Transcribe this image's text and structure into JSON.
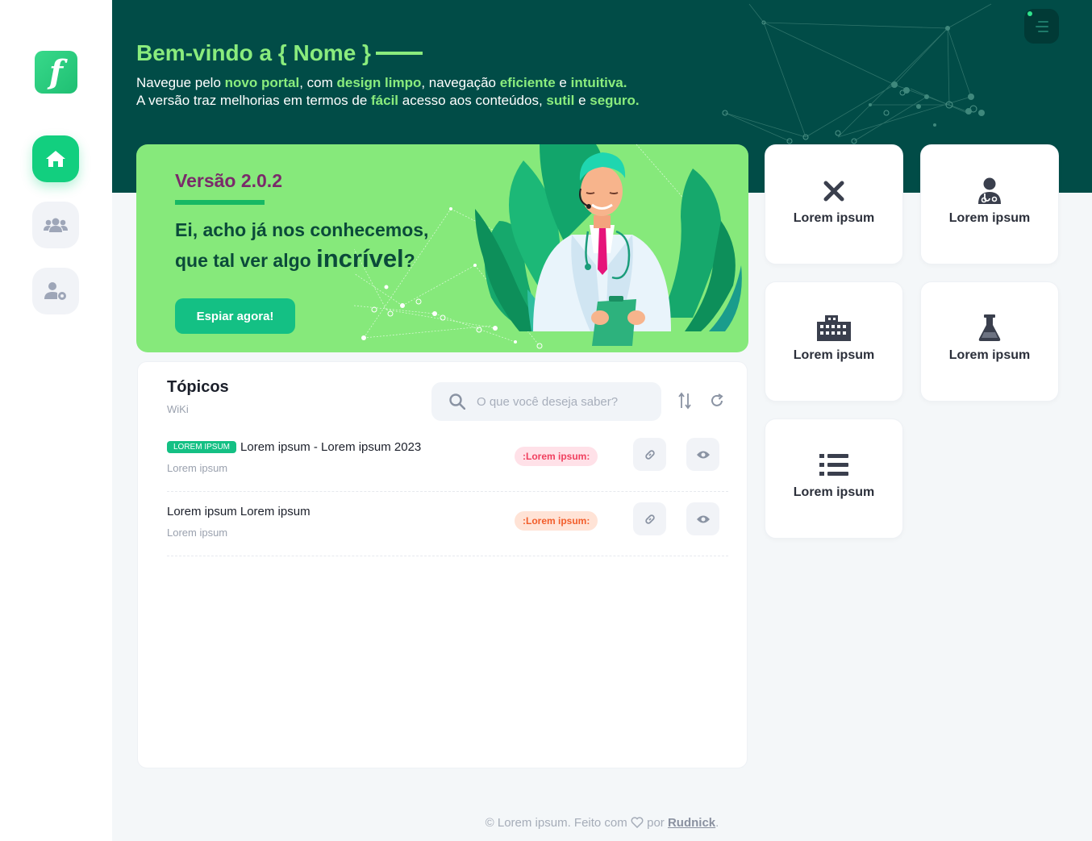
{
  "sidebar": {
    "logo_letter": "f",
    "items": [
      {
        "name": "home",
        "icon": "home-icon",
        "active": true
      },
      {
        "name": "users",
        "icon": "users-icon",
        "active": false
      },
      {
        "name": "user-settings",
        "icon": "user-gear-icon",
        "active": false
      }
    ]
  },
  "header": {
    "welcome": "Bem-vindo a { Nome }",
    "line1": {
      "p1": "Navegue pelo ",
      "h1": "novo portal",
      "p2": ", com ",
      "h2": "design limpo",
      "p3": ", navegação ",
      "h3": "eficiente",
      "p4": " e ",
      "h4": "intuitiva."
    },
    "line2": {
      "p1": "A versão traz melhorias em termos de ",
      "h1": "fácil",
      "p2": " acesso aos conteúdos, ",
      "h2": "sutil",
      "p3": " e ",
      "h3": "seguro."
    },
    "menu_icon": "menu-icon"
  },
  "banner": {
    "version": "Versão 2.0.2",
    "headline_line1": "Ei, acho já nos conhecemos,",
    "headline_line2_pre": "que tal ver algo ",
    "headline_line2_big": "incrível",
    "headline_line2_post": "?",
    "cta": "Espiar agora!"
  },
  "topics": {
    "title": "Tópicos",
    "subtitle": "WiKi",
    "search_placeholder": "O que você deseja saber?",
    "rows": [
      {
        "tag": "LOREM IPSUM",
        "title": "Lorem ipsum - Lorem ipsum 2023",
        "meta": "Lorem ipsum",
        "status": ":Lorem ipsum:",
        "status_color": "#f0405f"
      },
      {
        "tag": "",
        "title": "Lorem ipsum Lorem ipsum",
        "meta": "Lorem ipsum",
        "status": ":Lorem ipsum:",
        "status_color": "#f25d2a"
      }
    ]
  },
  "tiles": [
    {
      "label": "Lorem ipsum",
      "icon": "close-icon"
    },
    {
      "label": "Lorem ipsum",
      "icon": "doctor-icon"
    },
    {
      "label": "Lorem ipsum",
      "icon": "building-icon"
    },
    {
      "label": "Lorem ipsum",
      "icon": "flask-icon"
    },
    {
      "label": "Lorem ipsum",
      "icon": "list-icon"
    }
  ],
  "footer": {
    "text": "© Lorem ipsum. Feito com",
    "by": "por",
    "author": "Rudnick",
    "end": "."
  },
  "colors": {
    "accent_green": "#12cf7f",
    "header_bg": "#014c47",
    "banner_bg": "#86e97b",
    "highlight": "#8aec7d"
  }
}
